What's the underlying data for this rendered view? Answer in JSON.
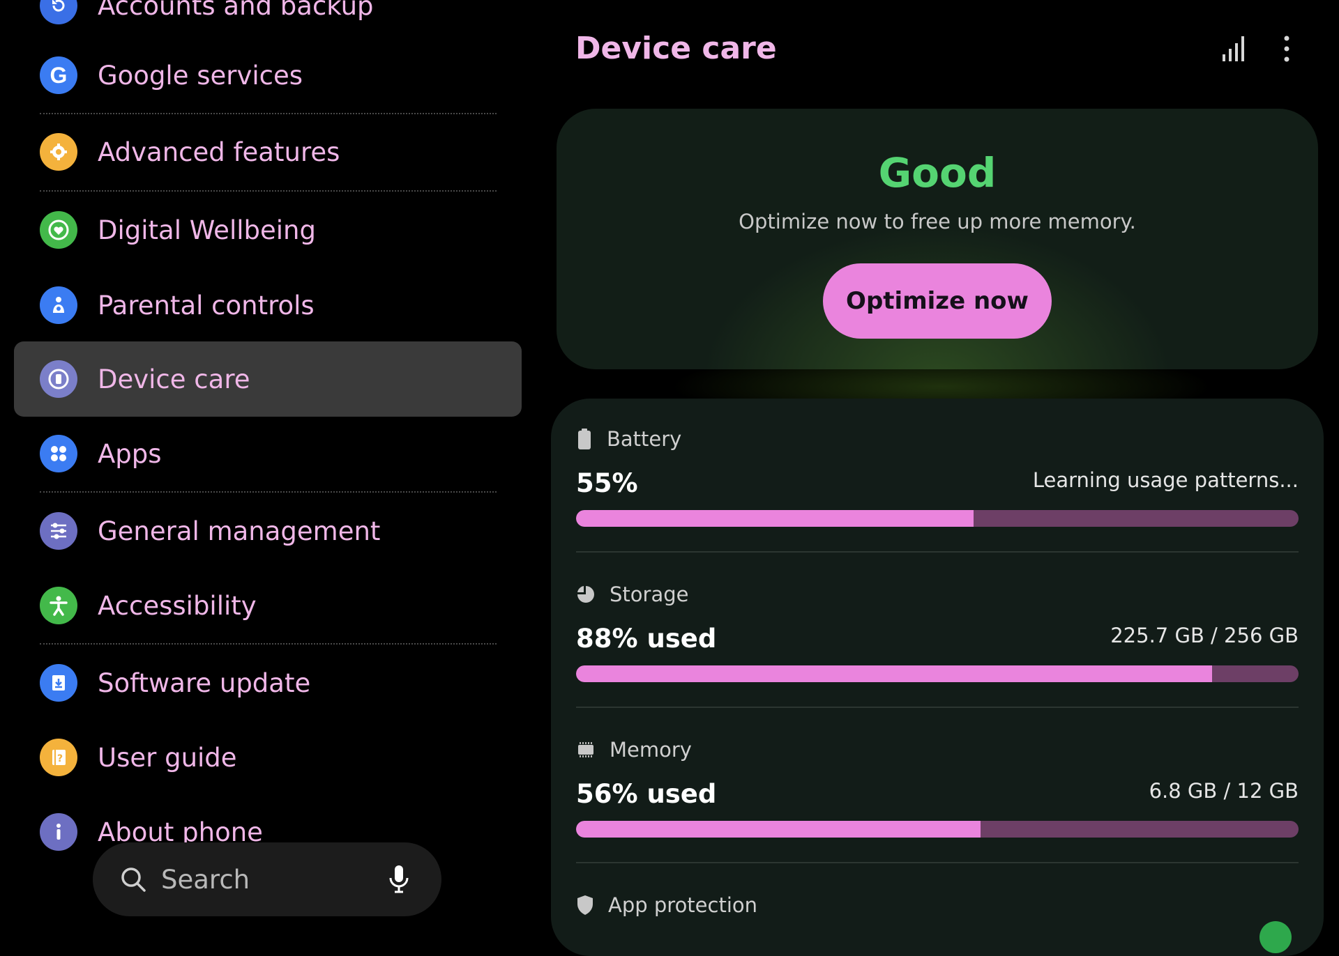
{
  "sidebar": {
    "items": [
      {
        "label": "Accounts and backup",
        "icon": "accounts-backup-icon",
        "color": "#3a6fe6"
      },
      {
        "label": "Google services",
        "icon": "google-icon",
        "color": "#3b7cf2"
      },
      {
        "label": "Advanced features",
        "icon": "advanced-features-icon",
        "color": "#f4b23c"
      },
      {
        "label": "Digital Wellbeing",
        "icon": "digital-wellbeing-icon",
        "color": "#43b94a"
      },
      {
        "label": "Parental controls",
        "icon": "parental-controls-icon",
        "color": "#3b7cf2"
      },
      {
        "label": "Device care",
        "icon": "device-care-icon",
        "color": "#7b7fc9",
        "selected": true
      },
      {
        "label": "Apps",
        "icon": "apps-icon",
        "color": "#3b7cf2"
      },
      {
        "label": "General management",
        "icon": "general-management-icon",
        "color": "#6d6fc2"
      },
      {
        "label": "Accessibility",
        "icon": "accessibility-icon",
        "color": "#43b94a"
      },
      {
        "label": "Software update",
        "icon": "software-update-icon",
        "color": "#3b7cf2"
      },
      {
        "label": "User guide",
        "icon": "user-guide-icon",
        "color": "#f4b23c"
      },
      {
        "label": "About phone",
        "icon": "about-phone-icon",
        "color": "#6d6fc2"
      }
    ],
    "search": {
      "label": "Search"
    }
  },
  "header": {
    "title": "Device care"
  },
  "status": {
    "rating": "Good",
    "message": "Optimize now to free up more memory.",
    "button": "Optimize now",
    "rating_color": "#55d472",
    "accent_color": "#ea84dd"
  },
  "stats": {
    "battery": {
      "label": "Battery",
      "value": "55%",
      "side": "Learning usage patterns...",
      "fill": 0.55
    },
    "storage": {
      "label": "Storage",
      "value": "88% used",
      "side": "225.7 GB / 256 GB",
      "fill": 0.88
    },
    "memory": {
      "label": "Memory",
      "value": "56% used",
      "side": "6.8 GB / 12 GB",
      "fill": 0.56
    },
    "app_protection": {
      "label": "App protection"
    }
  }
}
